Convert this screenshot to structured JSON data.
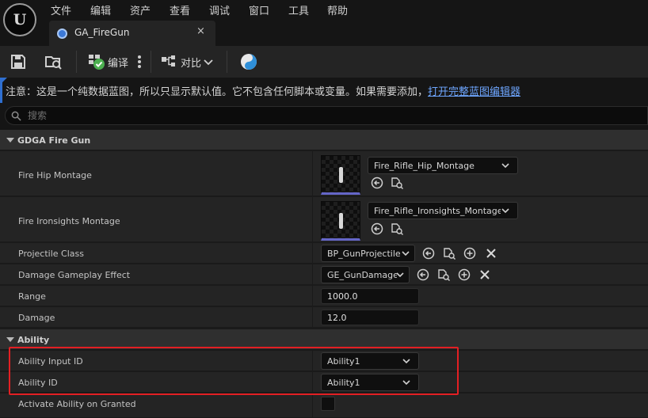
{
  "logo": {
    "glyph": "U"
  },
  "menu": {
    "items": [
      "文件",
      "编辑",
      "资产",
      "查看",
      "调试",
      "窗口",
      "工具",
      "帮助"
    ]
  },
  "tab": {
    "title": "GA_FireGun",
    "close": "×",
    "icon": "blueprint-icon"
  },
  "toolbar": {
    "save_icon": "save-icon",
    "browse_icon": "browse-icon",
    "compile_label": "编译",
    "compile_status": "success",
    "more_icon": "vertical-dots-icon",
    "diff_label": "对比",
    "class_settings_icon": "class-settings-icon"
  },
  "notice": {
    "text": "注意：这是一个纯数据蓝图，所以只显示默认值。它不包含任何脚本或变量。如果需要添加，",
    "link": "打开完整蓝图编辑器"
  },
  "search": {
    "placeholder": "搜索"
  },
  "details": {
    "categories": [
      {
        "label": "GDGA Fire Gun"
      },
      {
        "label": "Ability"
      }
    ],
    "fire_hip_montage": {
      "label": "Fire Hip Montage",
      "value": "Fire_Rifle_Hip_Montage"
    },
    "fire_ironsights_montage": {
      "label": "Fire Ironsights Montage",
      "value": "Fire_Rifle_Ironsights_Montage"
    },
    "projectile_class": {
      "label": "Projectile Class",
      "value": "BP_GunProjectile"
    },
    "damage_effect": {
      "label": "Damage Gameplay Effect",
      "value": "GE_GunDamage"
    },
    "range": {
      "label": "Range",
      "value": "1000.0"
    },
    "damage": {
      "label": "Damage",
      "value": "12.0"
    },
    "ability_input_id": {
      "label": "Ability Input ID",
      "value": "Ability1"
    },
    "ability_id": {
      "label": "Ability ID",
      "value": "Ability1"
    },
    "activate_on_granted": {
      "label": "Activate Ability on Granted",
      "checked": false
    }
  },
  "colors": {
    "accent": "#2f6fd0",
    "link": "#6ea6ff",
    "highlight": "#e31f23",
    "thumbnail_underline": "#6566c8",
    "compile_ok": "#4caf50"
  }
}
